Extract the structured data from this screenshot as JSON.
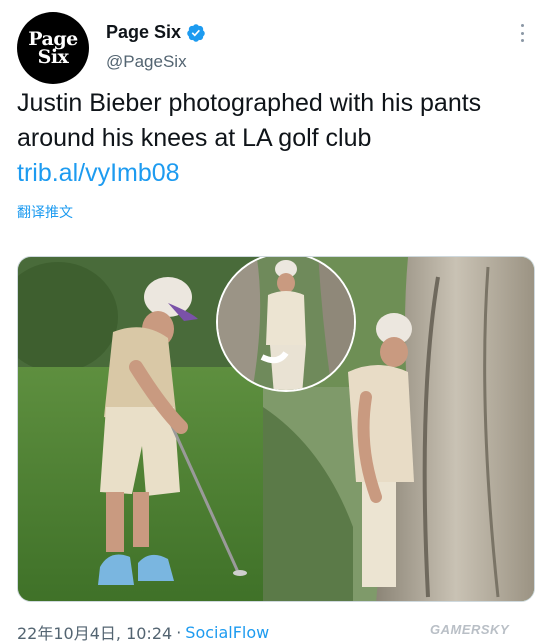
{
  "account": {
    "avatar_text_line1": "Page",
    "avatar_text_line2": "Six",
    "display_name": "Page Six",
    "handle": "@PageSix"
  },
  "tweet": {
    "text": "Justin Bieber photographed with his pants around his knees at LA golf club ",
    "link_text": "trib.al/vyImb08",
    "translate_label": "翻译推文"
  },
  "footer": {
    "timestamp": "22年10月4日, 10:24",
    "separator": "·",
    "source": "SocialFlow"
  },
  "watermark": "GAMERSKY",
  "colors": {
    "link": "#1d9bf0",
    "verified": "#1d9bf0",
    "secondary_text": "#536471"
  },
  "icons": {
    "verified": "verified-badge-icon",
    "more": "more-options-icon"
  }
}
